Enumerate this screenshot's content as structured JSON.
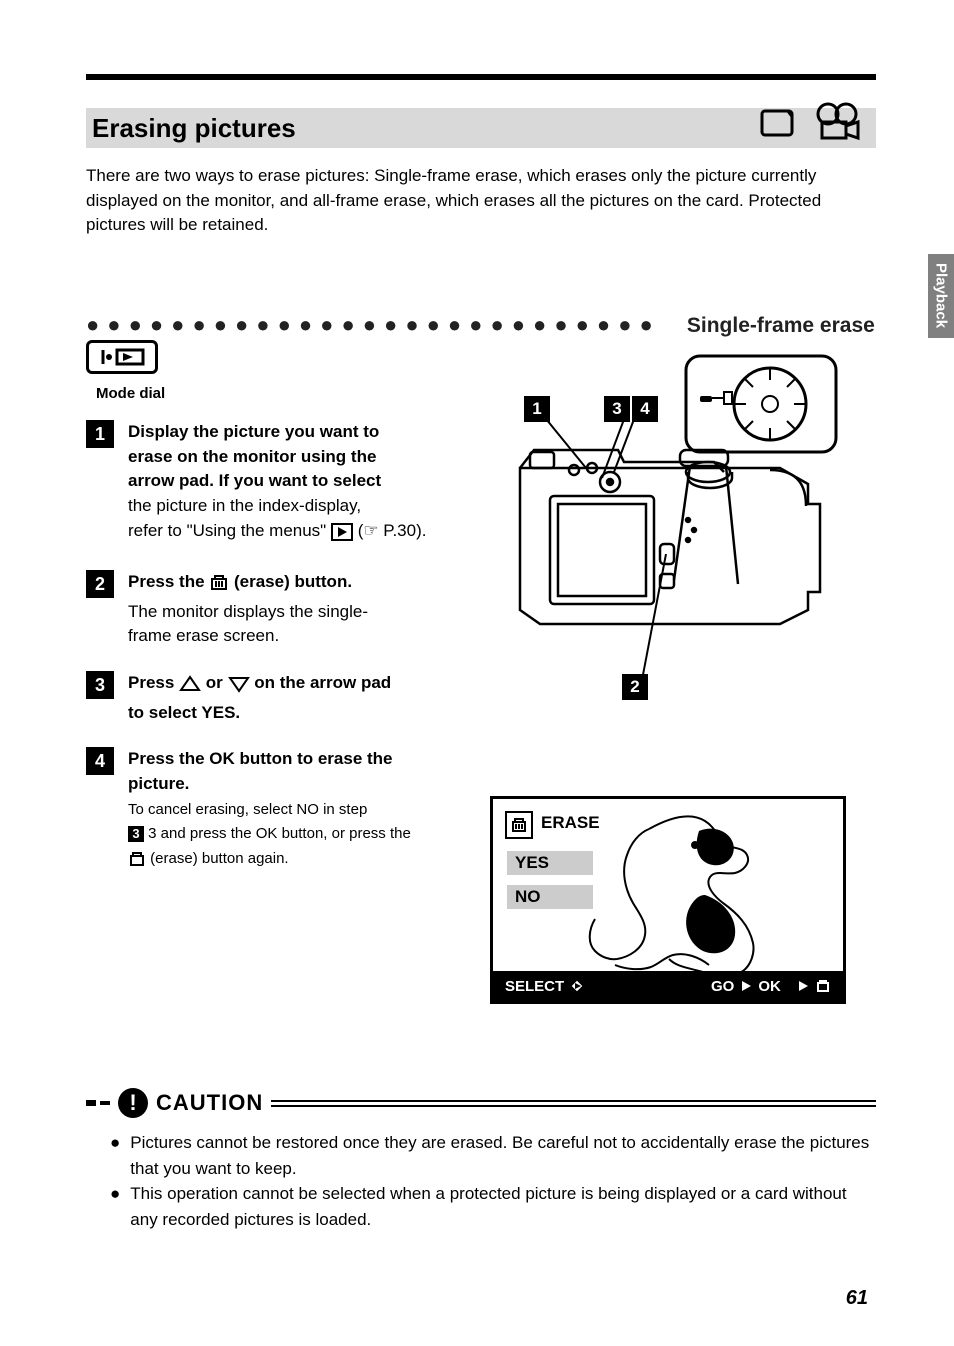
{
  "title": "Erasing pictures",
  "intro": "There are two ways to erase pictures: Single-frame erase, which erases only the picture currently displayed on the monitor, and all-frame erase, which erases all the pictures on the card. Protected pictures will be retained.",
  "dots_label": "Single-frame erase",
  "mode_label": "Mode dial",
  "steps": [
    {
      "num": "1",
      "lines": [
        "Display the picture you want to",
        "erase on the monitor using the",
        "arrow pad. If you want to select",
        "the picture in the index-display,",
        "refer to \"Using the menus\""
      ],
      "trail": "(☞ P.30)."
    },
    {
      "num": "2",
      "lines": [
        "Press the      (erase) button.",
        "The monitor displays the single-",
        "frame erase screen."
      ]
    },
    {
      "num": "3",
      "lines": [
        "Press       or        on the arrow pad",
        "to select YES."
      ]
    },
    {
      "num": "4",
      "lines": [
        "Press the OK button to erase the",
        "picture.",
        "To cancel erasing, select NO in step"
      ]
    }
  ],
  "clr_3_tail": "3 and press the OK button, or press the",
  "clr_final": " (erase) button again.",
  "lcd": {
    "erase_menu": "ERASE",
    "opt_yes": "YES",
    "opt_no": "NO",
    "footer_select": "SELECT",
    "footer_go": "GO",
    "footer_ok": "OK"
  },
  "diag_nums": {
    "a": "1",
    "b": "3",
    "c": "4",
    "d": "2"
  },
  "caution_title": "CAUTION",
  "caution_items": [
    "Pictures cannot be restored once they are erased. Be careful not to accidentally erase the pictures that you want to keep.",
    "This operation cannot be selected when a protected picture is being displayed or a card without any recorded pictures is loaded."
  ],
  "side_tab": "Playback",
  "page_num": "61"
}
